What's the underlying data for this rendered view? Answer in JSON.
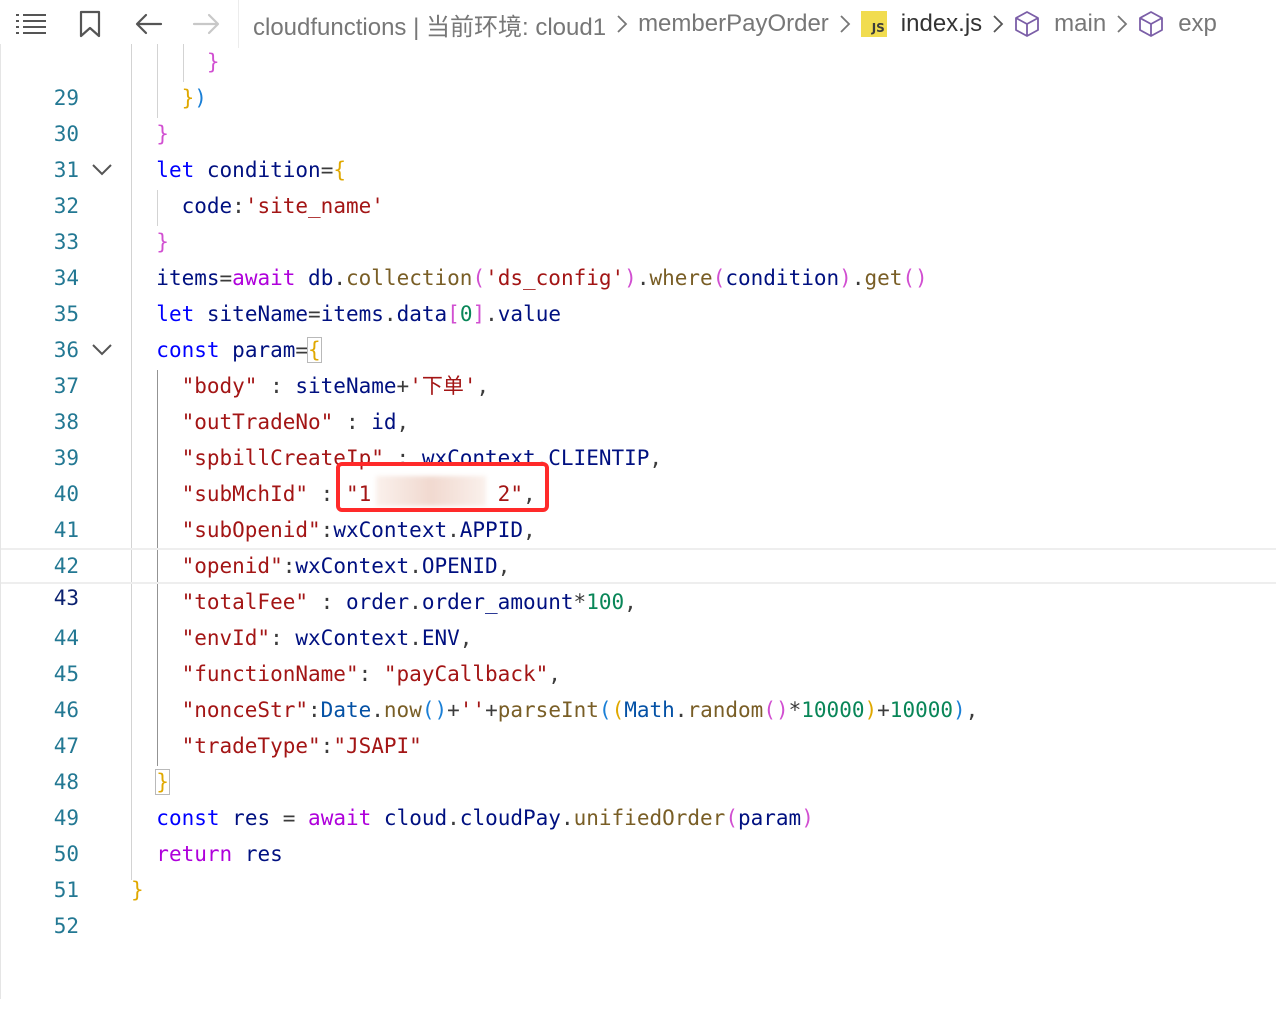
{
  "toolbar": {
    "breadcrumb": {
      "root": "cloudfunctions | 当前环境: cloud1",
      "folder": "memberPayOrder",
      "file_badge": "JS",
      "file": "index.js",
      "symbol1": "main",
      "symbol2": "exp"
    }
  },
  "colors": {
    "keyword": "#0000ff",
    "string": "#a31515",
    "number": "#098658",
    "function": "#795e26",
    "line_number": "#237893",
    "annotation": "#ff2a2a"
  },
  "editor": {
    "current_line": "43",
    "lines": [
      {
        "n": "29",
        "text": "}"
      },
      {
        "n": "30",
        "text": "})"
      },
      {
        "n": "31",
        "text": "}"
      },
      {
        "n": "32",
        "text": "let condition={"
      },
      {
        "n": "33",
        "text": "code:'site_name'"
      },
      {
        "n": "34",
        "text": "}"
      },
      {
        "n": "35",
        "text": "items=await db.collection('ds_config').where(condition).get()"
      },
      {
        "n": "36",
        "text": "let siteName=items.data[0].value"
      },
      {
        "n": "37",
        "text": "const param={"
      },
      {
        "n": "38",
        "text": "\"body\" : siteName+'下单',"
      },
      {
        "n": "39",
        "text": "\"outTradeNo\" : id,"
      },
      {
        "n": "40",
        "text": "\"spbillCreateIp\" : wxContext.CLIENTIP,"
      },
      {
        "n": "41",
        "text": "\"subMchId\" : \"1          2\","
      },
      {
        "n": "42",
        "text": "\"subOpenid\":wxContext.APPID,"
      },
      {
        "n": "43",
        "text": "\"openid\":wxContext.OPENID,"
      },
      {
        "n": "44",
        "text": "\"totalFee\" : order.order_amount*100,"
      },
      {
        "n": "45",
        "text": "\"envId\": wxContext.ENV,"
      },
      {
        "n": "46",
        "text": "\"functionName\": \"payCallback\","
      },
      {
        "n": "47",
        "text": "\"nonceStr\":Date.now()+''+parseInt((Math.random()*10000)+10000),"
      },
      {
        "n": "48",
        "text": "\"tradeType\":\"JSAPI\""
      },
      {
        "n": "49",
        "text": "}"
      },
      {
        "n": "50",
        "text": "const res = await cloud.cloudPay.unifiedOrder(param)"
      },
      {
        "n": "51",
        "text": "return res"
      },
      {
        "n": "52",
        "text": "}"
      }
    ]
  }
}
